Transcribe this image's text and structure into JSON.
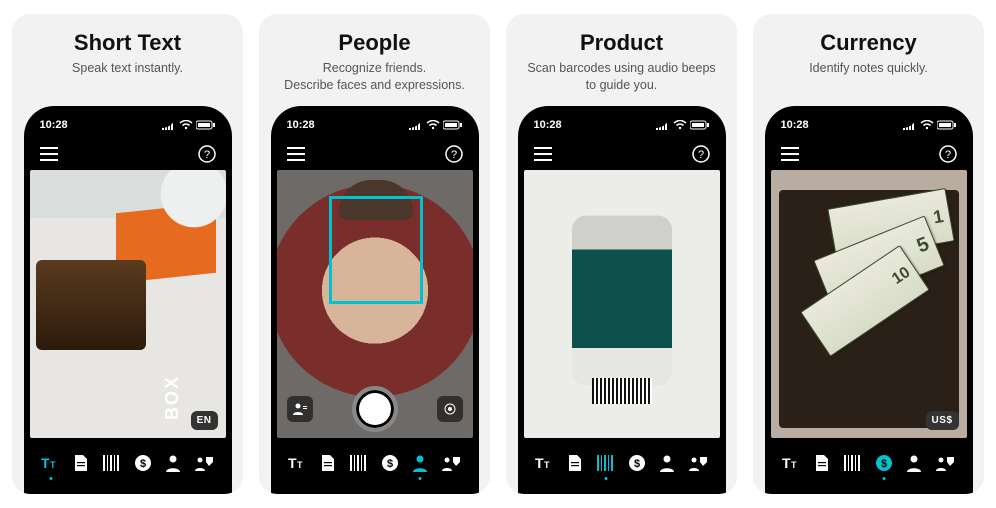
{
  "status_time": "10:28",
  "cards": [
    {
      "title": "Short Text",
      "subtitle": "Speak text instantly.",
      "lang_badge": "EN",
      "box_word": "BOX",
      "active_mode_index": 0
    },
    {
      "title": "People",
      "subtitle": "Recognize friends.\nDescribe faces and expressions.",
      "active_mode_index": 4
    },
    {
      "title": "Product",
      "subtitle": "Scan barcodes using audio beeps to guide you.",
      "active_mode_index": 2
    },
    {
      "title": "Currency",
      "subtitle": "Identify notes quickly.",
      "lang_badge": "US$",
      "bills": {
        "one": "1",
        "five": "5",
        "ten": "10"
      },
      "active_mode_index": 3
    }
  ],
  "modes": [
    {
      "name": "short-text",
      "icon": "text-icon"
    },
    {
      "name": "document",
      "icon": "document-icon"
    },
    {
      "name": "product",
      "icon": "barcode-icon"
    },
    {
      "name": "currency",
      "icon": "currency-icon"
    },
    {
      "name": "person",
      "icon": "person-icon"
    },
    {
      "name": "scene",
      "icon": "scene-icon"
    }
  ]
}
